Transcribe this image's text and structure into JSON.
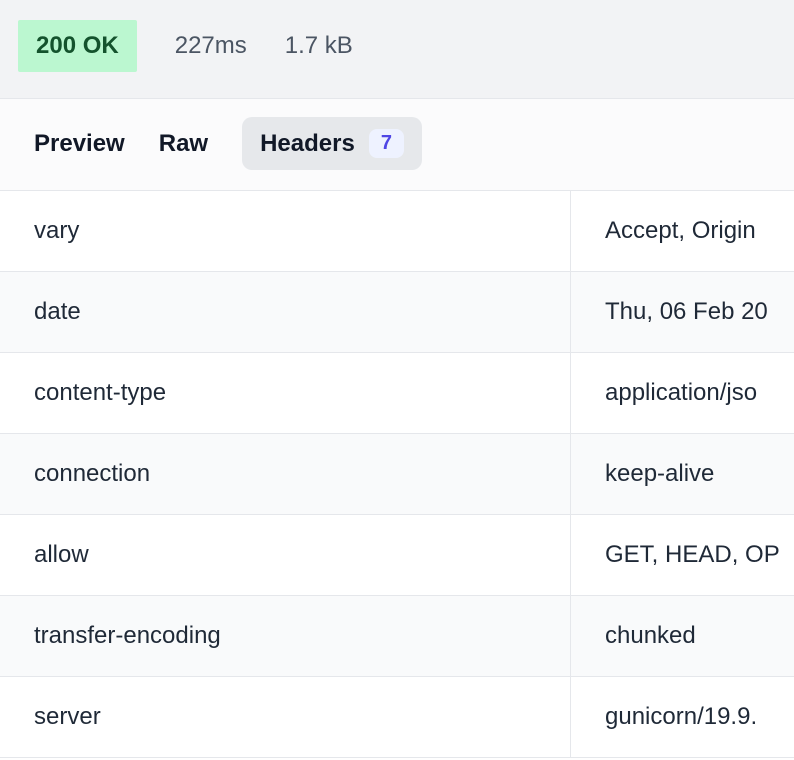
{
  "status": {
    "code_text": "200 OK",
    "time": "227ms",
    "size": "1.7 kB"
  },
  "tabs": {
    "preview": "Preview",
    "raw": "Raw",
    "headers": "Headers",
    "headers_count": "7"
  },
  "headers": [
    {
      "key": "vary",
      "value": "Accept, Origin"
    },
    {
      "key": "date",
      "value": "Thu, 06 Feb 20"
    },
    {
      "key": "content-type",
      "value": "application/jso"
    },
    {
      "key": "connection",
      "value": "keep-alive"
    },
    {
      "key": "allow",
      "value": "GET, HEAD, OP"
    },
    {
      "key": "transfer-encoding",
      "value": "chunked"
    },
    {
      "key": "server",
      "value": "gunicorn/19.9."
    }
  ]
}
